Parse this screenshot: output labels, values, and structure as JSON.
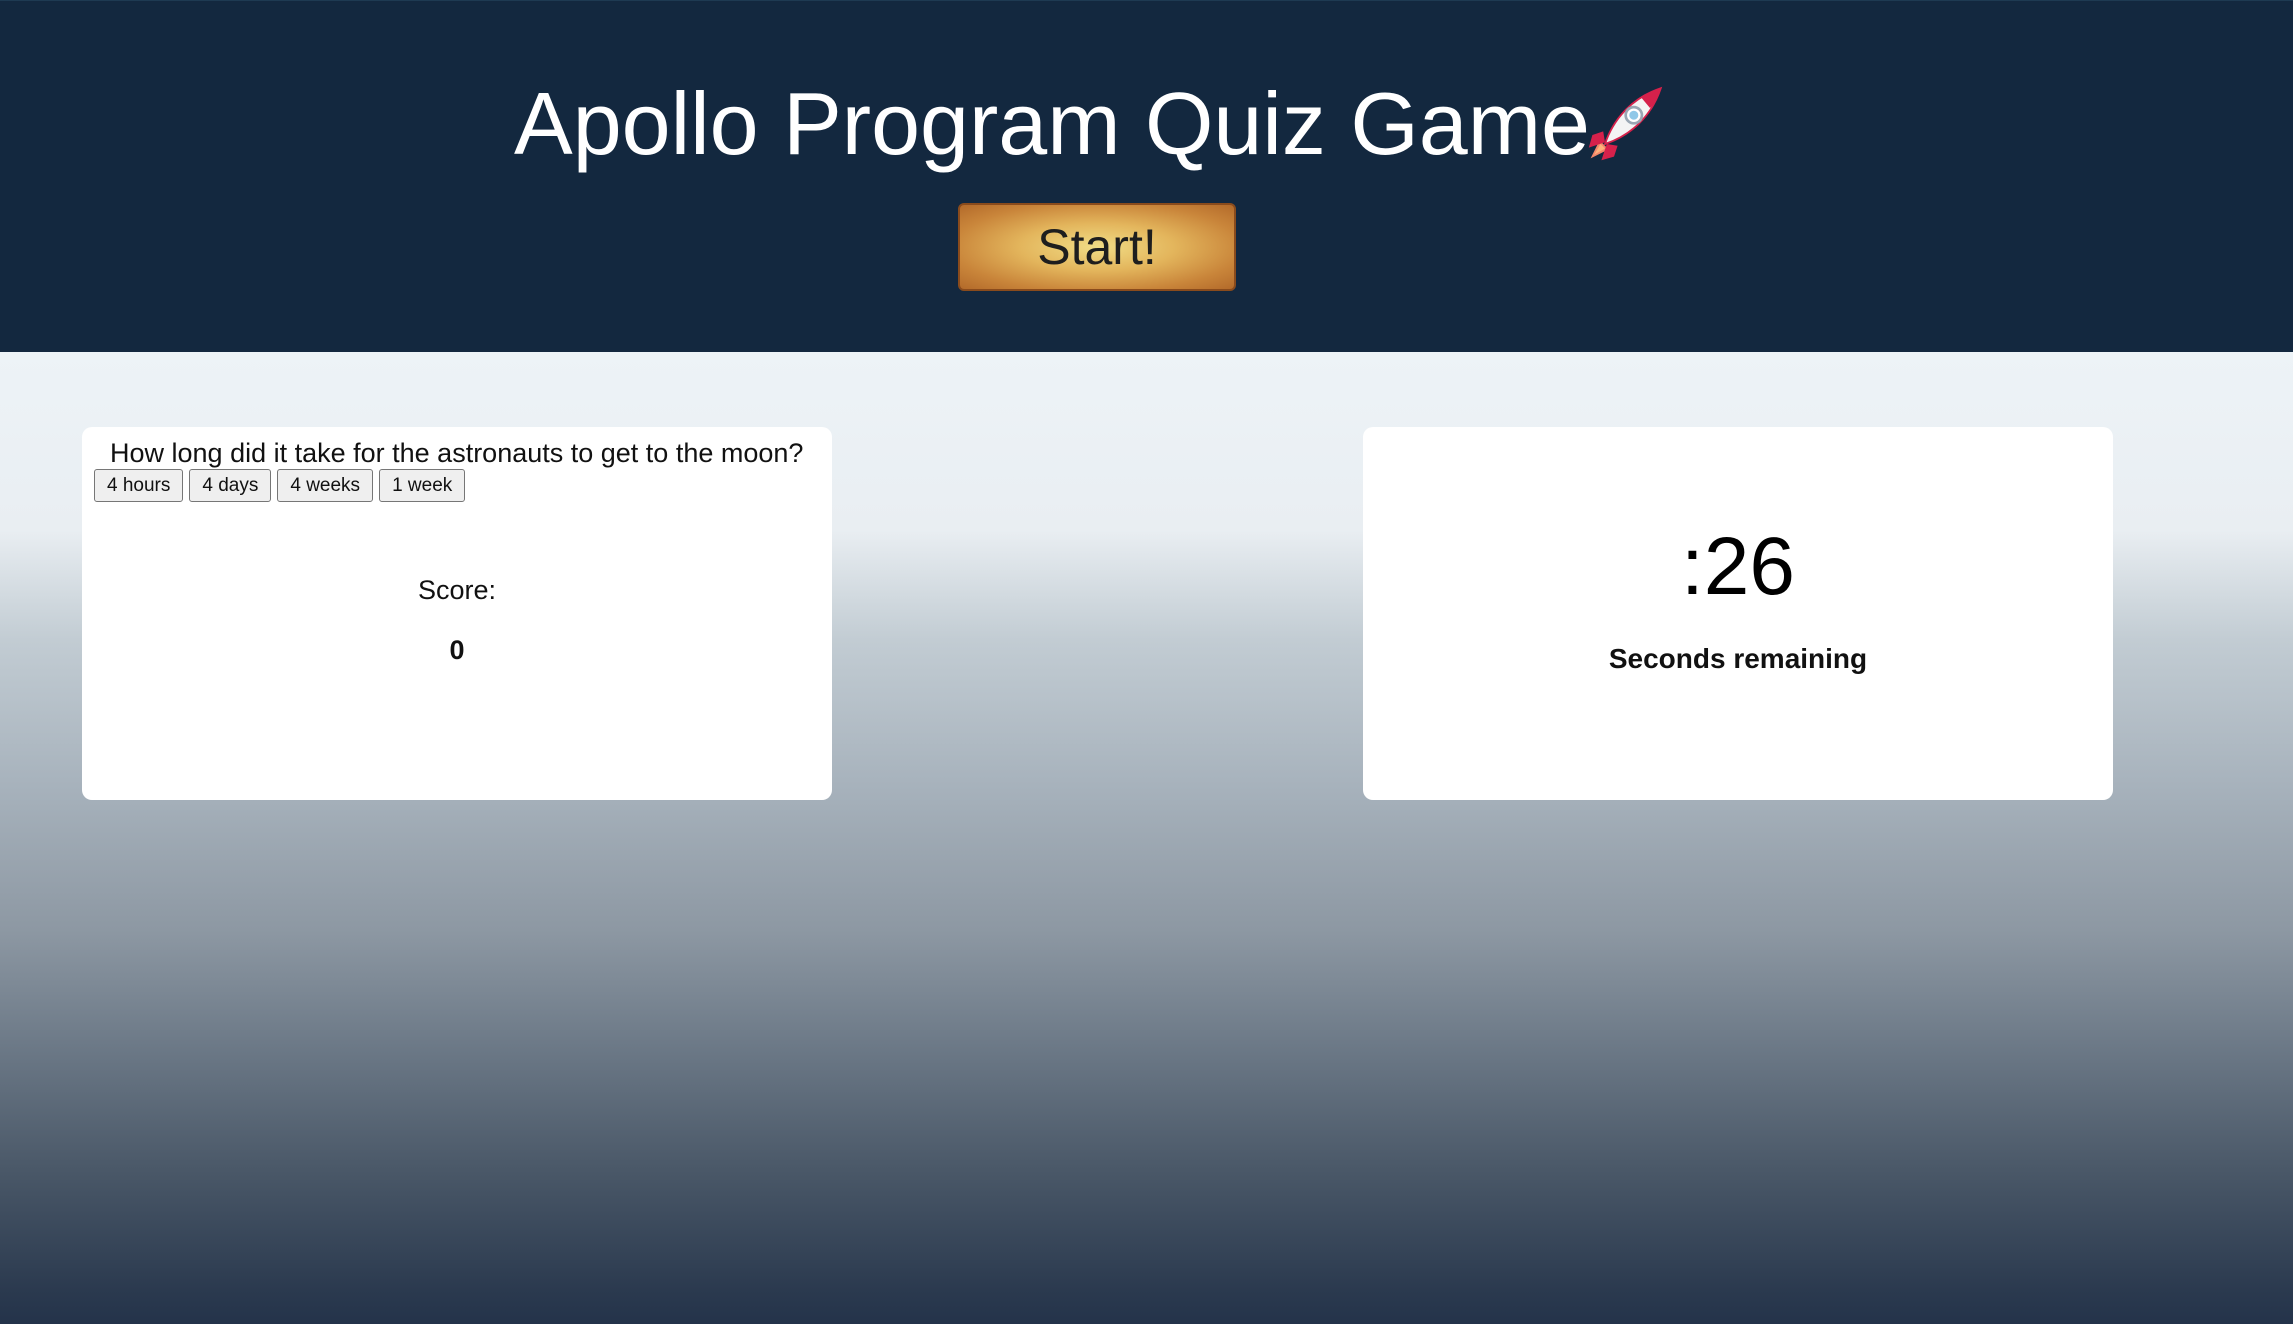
{
  "header": {
    "title": "Apollo Program Quiz Game",
    "title_icon": "rocket-icon",
    "start_label": "Start!"
  },
  "quiz": {
    "question": "How long did it take for the astronauts to get to the moon?",
    "answers": [
      "4 hours",
      "4 days",
      "4 weeks",
      "1 week"
    ],
    "score_label": "Score:",
    "score_value": "0"
  },
  "timer": {
    "value": ":26",
    "label": "Seconds remaining"
  },
  "colors": {
    "header_bg": "#13283f",
    "start_button": "#e3b55c",
    "card_bg": "#ffffff"
  }
}
